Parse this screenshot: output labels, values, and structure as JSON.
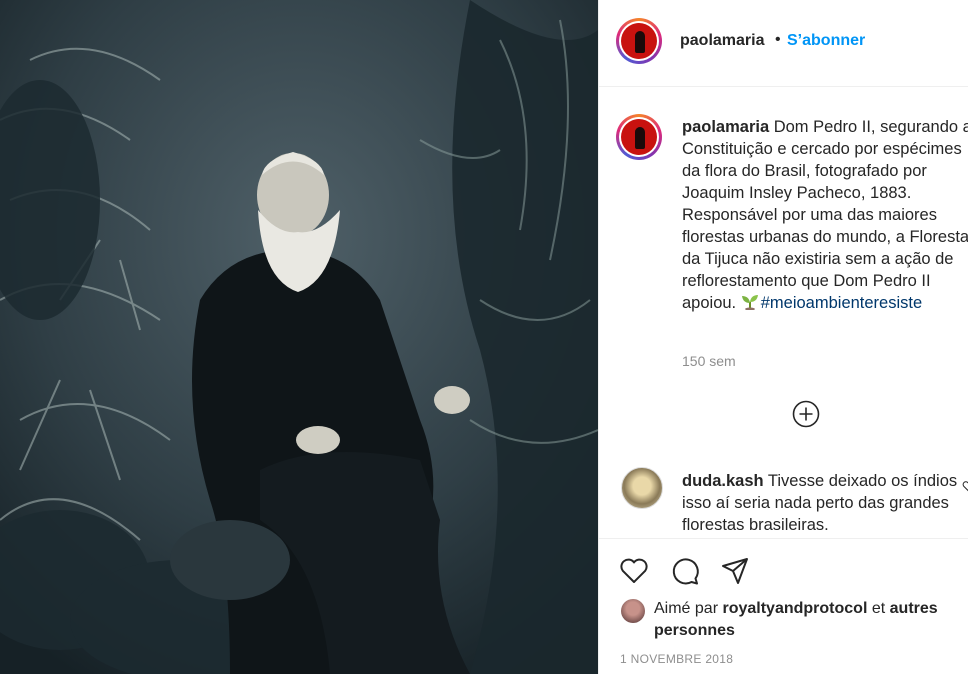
{
  "photo": {
    "description_icon": "portrait-photo"
  },
  "header": {
    "username": "paolamaria",
    "separator": "•",
    "follow_label": "S’abonner"
  },
  "caption": {
    "username": "paolamaria",
    "text": "Dom Pedro II, segurando a Constituição e cercado por espécimes da flora do Brasil, fotografado por Joaquim Insley Pacheco, 1883. Responsável por uma das maiores florestas urbanas do mundo, a Floresta da Tijuca não existiria sem a ação de reflorestamento que Dom Pedro II apoiou.",
    "hashtag": "#meioambienteresiste",
    "time": "150 sem"
  },
  "comment": {
    "username": "duda.kash",
    "text": "Tivesse deixado os índios isso aí seria nada perto das grandes florestas brasileiras."
  },
  "likes": {
    "prefix": "Aimé par",
    "user": "royaltyandprotocol",
    "connector": "et",
    "others": "autres personnes"
  },
  "date": "1 NOVEMBRE 2018",
  "colors": {
    "follow": "#0095f6",
    "hashtag": "#00376b",
    "muted": "#8e8e8e",
    "avatar_red": "#c8120f"
  }
}
